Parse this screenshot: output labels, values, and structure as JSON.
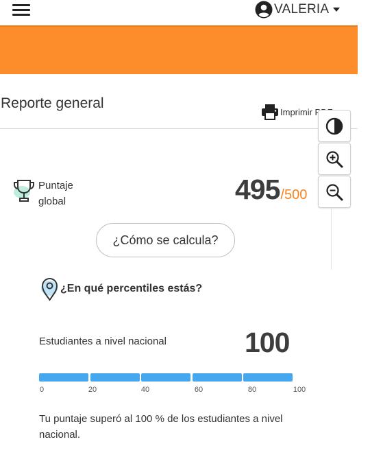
{
  "topbar": {
    "menu_icon": "hamburger-menu-icon",
    "user_icon": "account-circle-icon",
    "user_name": "VALERIA",
    "dropdown_icon": "caret-down-icon"
  },
  "banner": {
    "color": "#fd8c2b"
  },
  "header": {
    "title": "Reporte general",
    "print_label": "Imprimir PDF",
    "print_icon": "printer-icon"
  },
  "tools": [
    {
      "name": "contrast",
      "icon": "contrast-icon"
    },
    {
      "name": "zoom-in",
      "icon": "zoom-in-icon"
    },
    {
      "name": "zoom-out",
      "icon": "zoom-out-icon"
    }
  ],
  "score": {
    "label": "Puntaje global",
    "icon": "trophy-icon",
    "value": "495",
    "max": "/500",
    "max_color": "#f58220"
  },
  "calc_button": {
    "label": "¿Cómo se calcula?"
  },
  "percentiles": {
    "question": "¿En qué percentiles estás?",
    "icon": "location-pin-icon"
  },
  "national": {
    "label": "Estudiantes a nivel nacional",
    "value": "100",
    "bar_fill_percent": 100,
    "bar_color": "#45a8ee",
    "ticks": [
      "0",
      "20",
      "40",
      "60",
      "80",
      "100"
    ],
    "result_text": "Tu puntaje superó al 100 % de los estudiantes a nivel nacional."
  }
}
